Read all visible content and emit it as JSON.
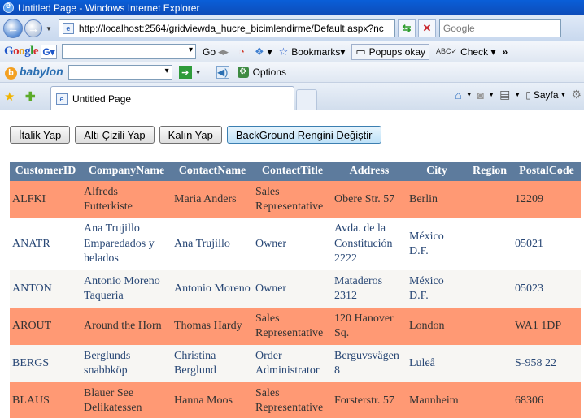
{
  "window": {
    "title": "Untitled Page - Windows Internet Explorer"
  },
  "address_bar": {
    "url": "http://localhost:2564/gridviewda_hucre_bicimlendirme/Default.aspx?nc",
    "search_placeholder": "Google"
  },
  "google_toolbar": {
    "logo": [
      "G",
      "o",
      "o",
      "g",
      "l",
      "e"
    ],
    "go_label": "Go",
    "bookmarks_label": "Bookmarks",
    "popups_label": "Popups okay",
    "check_label": "Check",
    "more_label": "»"
  },
  "babylon_toolbar": {
    "logo": "babylon",
    "options_label": "Options"
  },
  "tabs": {
    "active_title": "Untitled Page"
  },
  "command_bar": {
    "page_label": "Sayfa"
  },
  "buttons": {
    "italic": "İtalik Yap",
    "underline": "Altı Çizili Yap",
    "bold": "Kalın Yap",
    "background": "BackGround Rengini Değiştir"
  },
  "grid": {
    "columns": [
      "CustomerID",
      "CompanyName",
      "ContactName",
      "ContactTitle",
      "Address",
      "City",
      "Region",
      "PostalCode"
    ],
    "rows": [
      {
        "style": "alt",
        "cells": [
          "ALFKI",
          "Alfreds Futterkiste",
          "Maria Anders",
          "Sales Representative",
          "Obere Str. 57",
          "Berlin",
          "",
          "12209"
        ]
      },
      {
        "style": "norm2",
        "cells": [
          "ANATR",
          "Ana Trujillo Emparedados y helados",
          "Ana Trujillo",
          "Owner",
          "Avda. de la Constitución 2222",
          "México D.F.",
          "",
          "05021"
        ]
      },
      {
        "style": "norm",
        "cells": [
          "ANTON",
          "Antonio Moreno Taqueria",
          "Antonio Moreno",
          "Owner",
          "Mataderos 2312",
          "México D.F.",
          "",
          "05023"
        ]
      },
      {
        "style": "alt",
        "cells": [
          "AROUT",
          "Around the Horn",
          "Thomas Hardy",
          "Sales Representative",
          "120 Hanover Sq.",
          "London",
          "",
          "WA1 1DP"
        ]
      },
      {
        "style": "norm",
        "cells": [
          "BERGS",
          "Berglunds snabbköp",
          "Christina Berglund",
          "Order Administrator",
          "Berguvsvägen 8",
          "Luleå",
          "",
          "S-958 22"
        ]
      },
      {
        "style": "alt",
        "cells": [
          "BLAUS",
          "Blauer See Delikatessen",
          "Hanna Moos",
          "Sales Representative",
          "Forsterstr. 57",
          "Mannheim",
          "",
          "68306"
        ]
      }
    ]
  },
  "colors": {
    "header_bg": "#5d7b9d",
    "alt_row_bg": "#ff9974",
    "row_bg": "#f7f6f3"
  }
}
